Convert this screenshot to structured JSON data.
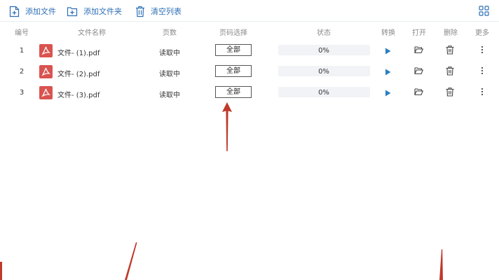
{
  "toolbar": {
    "add_file": "添加文件",
    "add_folder": "添加文件夹",
    "clear_list": "清空列表"
  },
  "columns": {
    "number": "编号",
    "filename": "文件名称",
    "pages": "页数",
    "page_range": "页码选择",
    "status": "状态",
    "convert": "转换",
    "open": "打开",
    "delete": "删除",
    "more": "更多"
  },
  "files": [
    {
      "number": "1",
      "name": "文件- (1).pdf",
      "pages": "读取中",
      "range": "全部",
      "progress": "0%"
    },
    {
      "number": "2",
      "name": "文件- (2).pdf",
      "pages": "读取中",
      "range": "全部",
      "progress": "0%"
    },
    {
      "number": "3",
      "name": "文件- (3).pdf",
      "pages": "读取中",
      "range": "全部",
      "progress": "0%"
    }
  ],
  "colors": {
    "toolbar_text": "#2c6fb4",
    "play_icon": "#2c7fc0",
    "pdf_icon": "#d9534f",
    "annotation_arrow": "#c0392b"
  },
  "icons": {
    "add_file": "file-plus-icon",
    "add_folder": "folder-plus-icon",
    "clear_list": "trash-icon",
    "view_toggle": "grid-icon",
    "convert": "play-icon",
    "open": "folder-open-icon",
    "delete": "trash-icon",
    "more": "kebab-icon"
  }
}
